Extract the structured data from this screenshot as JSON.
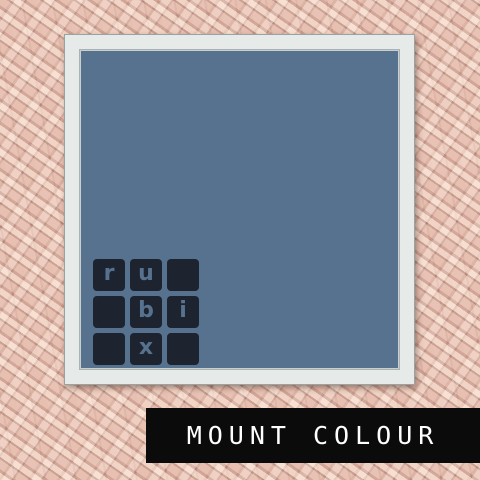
{
  "logo": {
    "tiles": [
      "r",
      "u",
      "",
      "",
      "b",
      "i",
      "",
      "x",
      ""
    ]
  },
  "caption": "MOUNT COLOUR",
  "colors": {
    "mount": "#56728f",
    "tile": "#1e2330",
    "frame": "#e6ebe9",
    "caption_background": "#0b0b0b",
    "caption_text": "#ffffff"
  }
}
